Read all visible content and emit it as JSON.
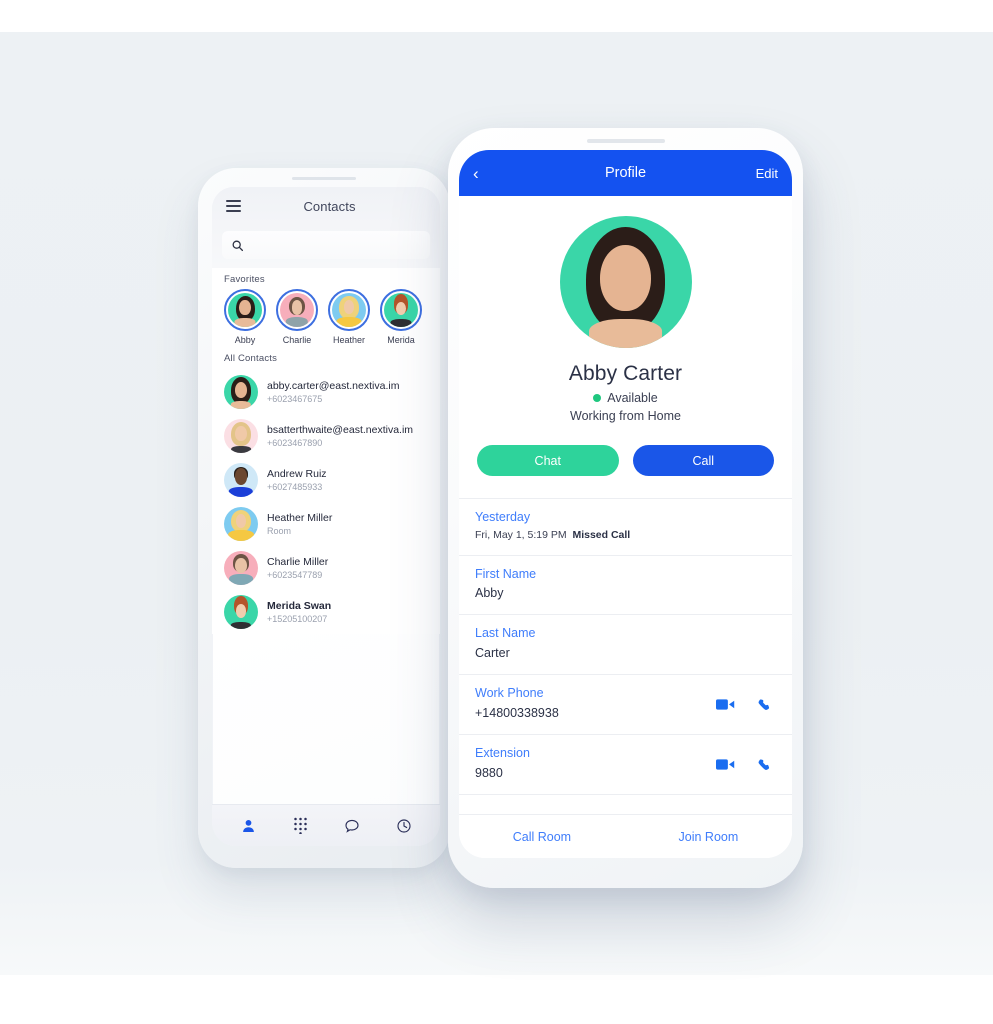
{
  "theme": {
    "backdrop": "#edf1f4",
    "primary_blue": "#1452f0",
    "link_blue": "#3f7dfb",
    "action_blue": "#1a56e8",
    "chat_green": "#2ed39b",
    "status_green": "#1fc77f",
    "text_dark": "#2b3146",
    "text_muted": "#9aa0ae"
  },
  "left_phone": {
    "header": {
      "menu_icon": "hamburger-menu-icon",
      "title": "Contacts"
    },
    "search": {
      "icon": "search-icon",
      "placeholder": "",
      "value": ""
    },
    "favorites_label": "Favorites",
    "favorites": [
      {
        "name": "Abby",
        "bg": "#3ad6a8",
        "hair": "#2b1d18",
        "skin": "#e5b492"
      },
      {
        "name": "Charlie",
        "bg": "#f7aebb",
        "hair": "#6d5445",
        "skin": "#e8c2a6"
      },
      {
        "name": "Heather",
        "bg": "#7ecbf0",
        "hair": "#efd27a",
        "skin": "#f0c9a8"
      },
      {
        "name": "Merida",
        "bg": "#3ad6a8",
        "hair": "#b4542a",
        "skin": "#f2cdae"
      }
    ],
    "all_contacts_label": "All Contacts",
    "contacts": [
      {
        "name": "abby.carter@east.nextiva.im",
        "sub": "+6023467675",
        "bold": false,
        "bg": "#3ad6a8",
        "hair": "#2b1d18",
        "skin": "#e5b492"
      },
      {
        "name": "bsatterthwaite@east.nextiva.im",
        "sub": "+6023467890",
        "bold": false,
        "bg": "#fbdfe4",
        "hair": "#e3c489",
        "skin": "#f0c9a8"
      },
      {
        "name": "Andrew Ruiz",
        "sub": "+6027485933",
        "bold": false,
        "bg": "#cfe8f7",
        "hair": "#2a211c",
        "skin": "#6b4730"
      },
      {
        "name": "Heather Miller",
        "sub": "Room",
        "bold": false,
        "bg": "#7ecbf0",
        "hair": "#efd27a",
        "skin": "#f0c9a8"
      },
      {
        "name": "Charlie Miller",
        "sub": "+6023547789",
        "bold": false,
        "bg": "#f7aebb",
        "hair": "#6d5445",
        "skin": "#e8c2a6"
      },
      {
        "name": "Merida Swan",
        "sub": "+15205100207",
        "bold": true,
        "bg": "#3ad6a8",
        "hair": "#b4542a",
        "skin": "#f2cdae"
      }
    ],
    "tabs": [
      {
        "icon": "person-icon",
        "label": "Contacts",
        "active": true
      },
      {
        "icon": "dialpad-icon",
        "label": "Keypad",
        "active": false
      },
      {
        "icon": "chat-bubble-icon",
        "label": "Messages",
        "active": false
      },
      {
        "icon": "clock-icon",
        "label": "Recents",
        "active": false
      }
    ]
  },
  "right_phone": {
    "header": {
      "back_icon": "chevron-left-icon",
      "back_label": "‹",
      "title": "Profile",
      "edit_label": "Edit"
    },
    "avatar": {
      "bg": "#3ad6a8",
      "alt": "contact-photo"
    },
    "name": "Abby Carter",
    "presence": "Available",
    "note": "Working from Home",
    "actions": [
      {
        "label": "Chat",
        "color": "#2ed39b",
        "name": "chat-button"
      },
      {
        "label": "Call",
        "color": "#1a56e8",
        "name": "call-button"
      }
    ],
    "activity": {
      "heading": "Yesterday",
      "timestamp": "Fri, May 1, 5:19 PM",
      "type": "Missed Call"
    },
    "fields": [
      {
        "key": "First Name",
        "value": "Abby",
        "icons": []
      },
      {
        "key": "Last Name",
        "value": "Carter",
        "icons": []
      },
      {
        "key": "Work Phone",
        "value": "+14800338938",
        "icons": [
          "video-camera-icon",
          "phone-handset-icon"
        ]
      },
      {
        "key": "Extension",
        "value": "9880",
        "icons": [
          "video-camera-icon",
          "phone-handset-icon"
        ]
      }
    ],
    "footer": [
      {
        "label": "Call Room",
        "name": "call-room-link"
      },
      {
        "label": "Join Room",
        "name": "join-room-link"
      }
    ]
  }
}
